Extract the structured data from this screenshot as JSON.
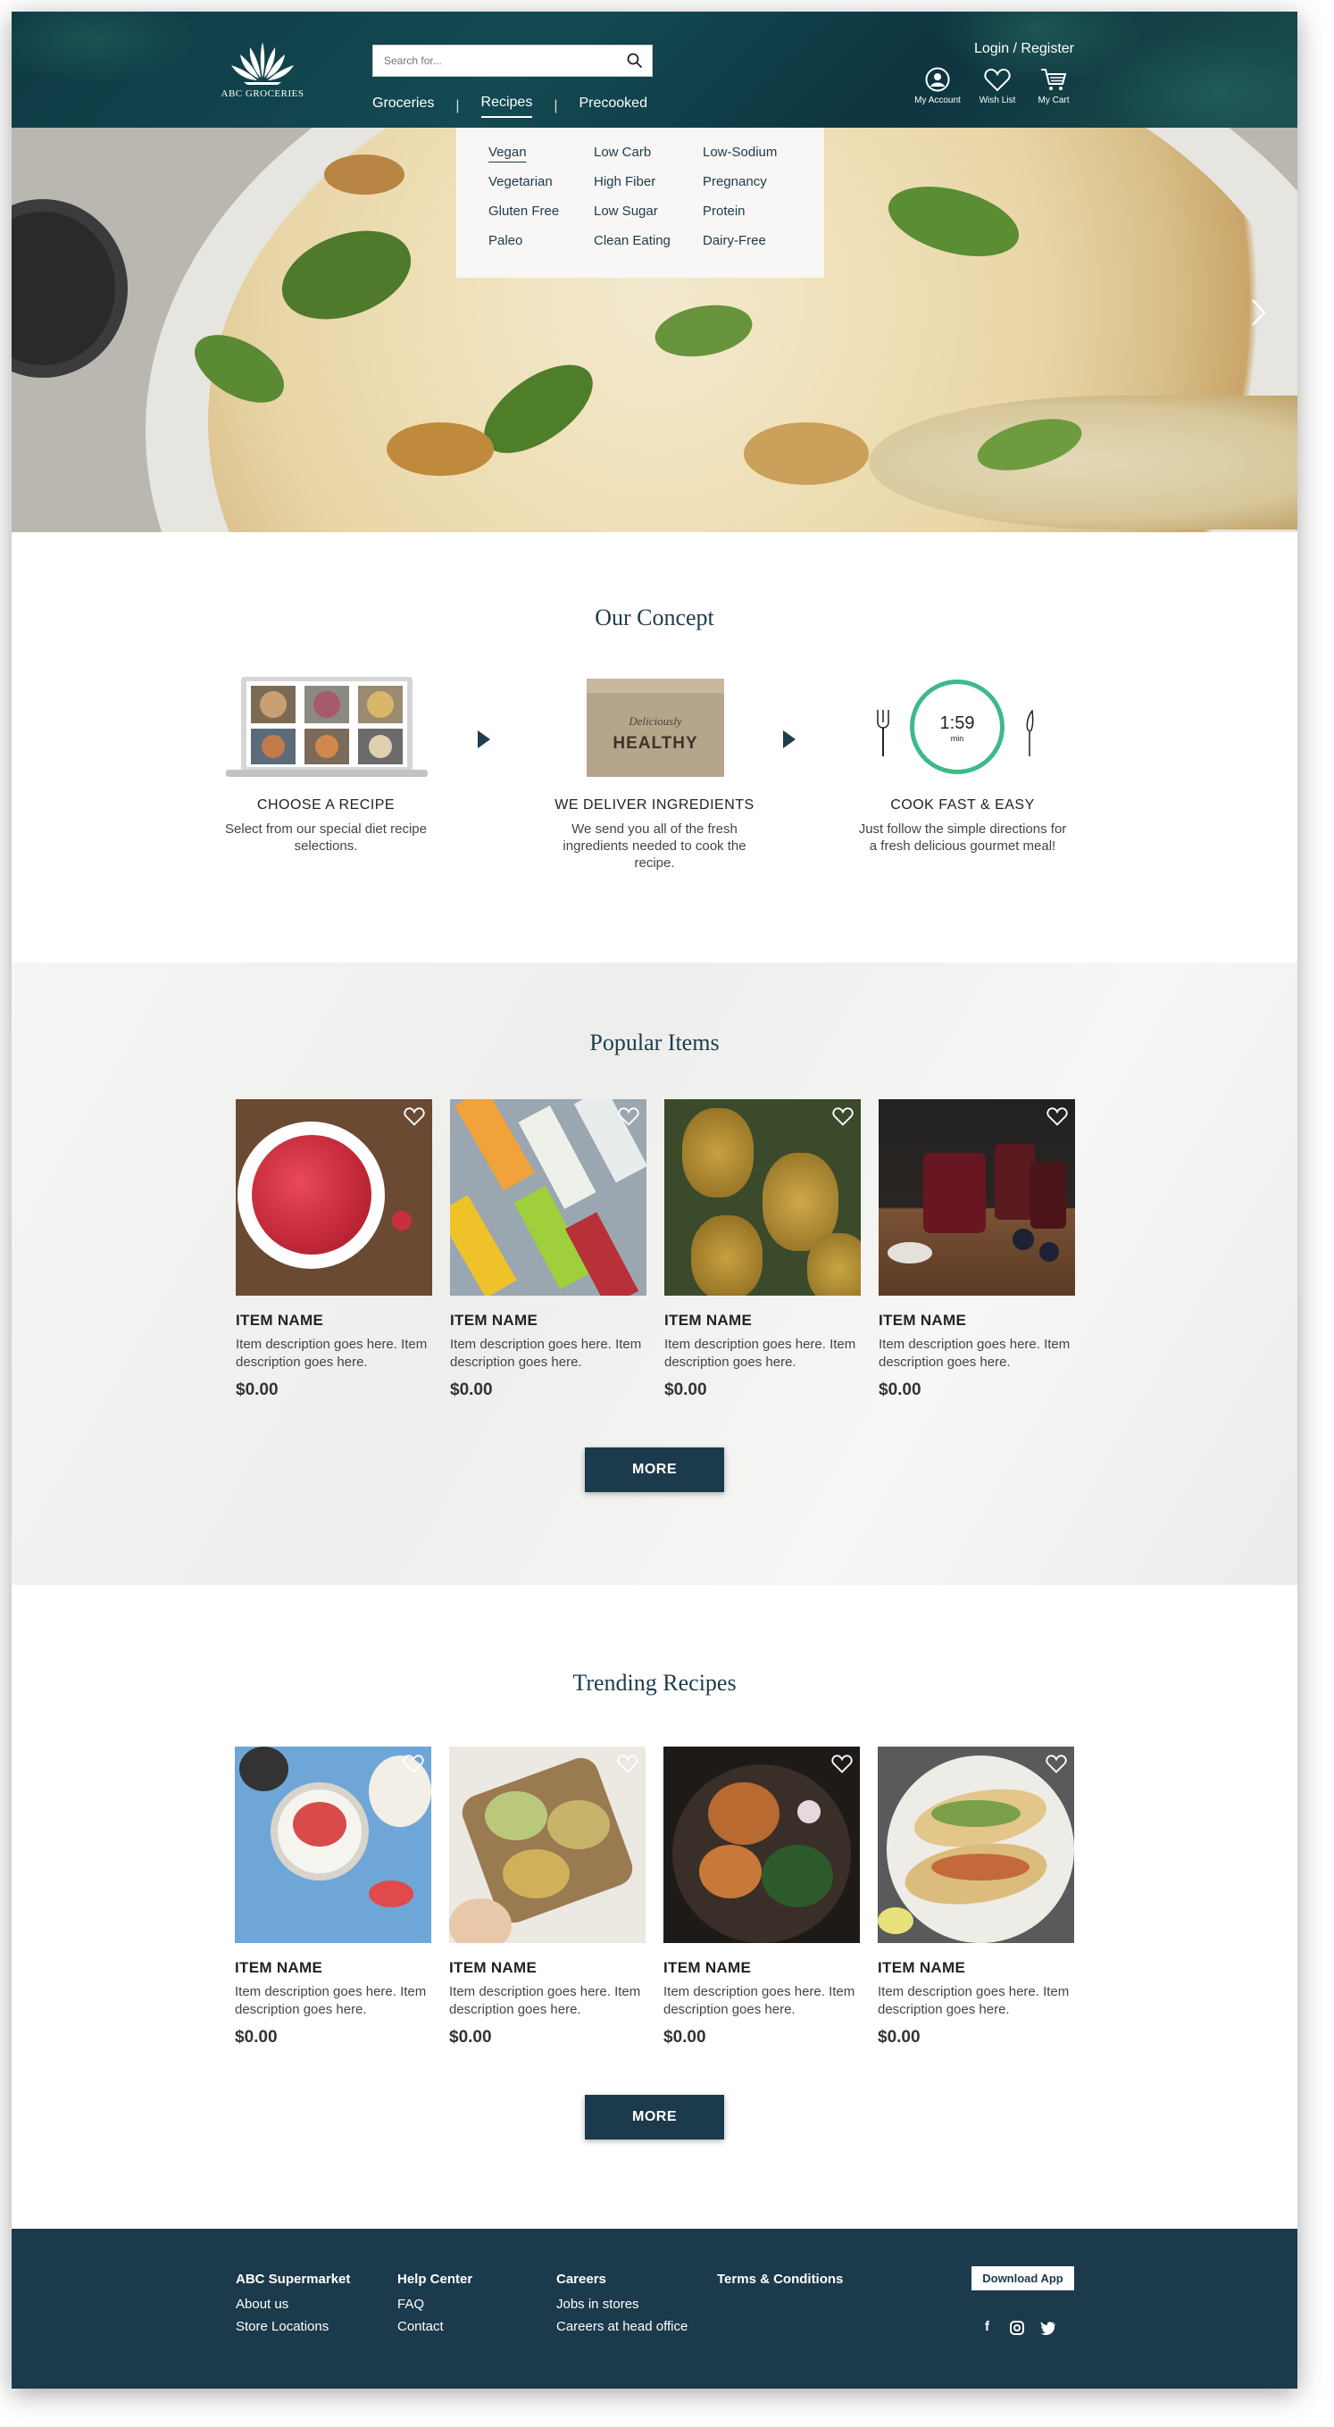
{
  "header": {
    "logo_text": "ABC GROCERIES",
    "search_placeholder": "Search for...",
    "nav": [
      "Groceries",
      "Recipes",
      "Precooked"
    ],
    "nav_active": "Recipes",
    "login": "Login / Register",
    "account": "My Account",
    "wishlist": "Wish List",
    "cart": "My Cart"
  },
  "recipes_menu": {
    "col1": [
      "Vegan",
      "Vegetarian",
      "Gluten Free",
      "Paleo"
    ],
    "col2": [
      "Low Carb",
      "High Fiber",
      "Low Sugar",
      "Clean Eating"
    ],
    "col3": [
      "Low-Sodium",
      "Pregnancy",
      "Protein",
      "Dairy-Free"
    ],
    "active": "Vegan"
  },
  "concept": {
    "title": "Our Concept",
    "box_script": "Deliciously",
    "box_word": "HEALTHY",
    "timer_value": "1:59",
    "timer_unit": "min",
    "steps": [
      {
        "title": "CHOOSE A RECIPE",
        "text": "Select from our special diet recipe selections."
      },
      {
        "title": "WE DELIVER INGREDIENTS",
        "text": "We send you all of the fresh ingredients needed to cook the recipe."
      },
      {
        "title": "COOK FAST & EASY",
        "text": "Just follow the simple directions for a fresh delicious gourmet meal!"
      }
    ]
  },
  "popular": {
    "title": "Popular Items",
    "items": [
      {
        "name": "ITEM NAME",
        "desc": "Item description goes here. Item description goes here.",
        "price": "$0.00"
      },
      {
        "name": "ITEM NAME",
        "desc": "Item description goes here. Item description goes here.",
        "price": "$0.00"
      },
      {
        "name": "ITEM NAME",
        "desc": "Item description goes here. Item description goes here.",
        "price": "$0.00"
      },
      {
        "name": "ITEM NAME",
        "desc": "Item description goes here. Item description goes here.",
        "price": "$0.00"
      }
    ],
    "more": "MORE"
  },
  "trending": {
    "title": "Trending Recipes",
    "items": [
      {
        "name": "ITEM NAME",
        "desc": "Item description goes here. Item description goes here.",
        "price": "$0.00"
      },
      {
        "name": "ITEM NAME",
        "desc": "Item description goes here. Item description goes here.",
        "price": "$0.00"
      },
      {
        "name": "ITEM NAME",
        "desc": "Item description goes here. Item description goes here.",
        "price": "$0.00"
      },
      {
        "name": "ITEM NAME",
        "desc": "Item description goes here. Item description goes here.",
        "price": "$0.00"
      }
    ],
    "more": "MORE"
  },
  "footer": {
    "columns": [
      {
        "heading": "ABC Supermarket",
        "links": [
          "About us",
          "Store Locations"
        ]
      },
      {
        "heading": "Help Center",
        "links": [
          "FAQ",
          "Contact"
        ]
      },
      {
        "heading": "Careers",
        "links": [
          "Jobs in stores",
          "Careers at head office"
        ]
      },
      {
        "heading": "Terms & Conditions",
        "links": []
      }
    ],
    "download": "Download App",
    "social_icons": [
      "facebook-icon",
      "instagram-icon",
      "twitter-icon"
    ]
  },
  "colors": {
    "header_bg": "#0f3a44",
    "brand_navy": "#1b3a4b",
    "timer_green": "#3cba88"
  }
}
